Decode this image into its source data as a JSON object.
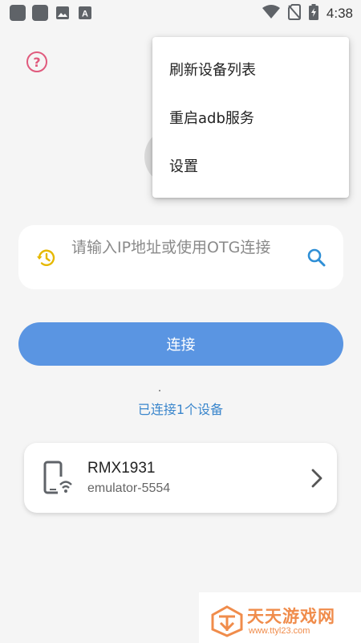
{
  "status_bar": {
    "time": "4:38",
    "icons": [
      "app-square-icon",
      "app-square-icon",
      "image-icon",
      "a-icon",
      "wifi-icon",
      "no-sim-icon",
      "battery-charging-icon"
    ]
  },
  "help_icon": "question-circle-icon",
  "menu": {
    "items": [
      "刷新设备列表",
      "重启adb服务",
      "设置"
    ]
  },
  "search": {
    "placeholder": "请输入IP地址或使用OTG连接",
    "history_icon": "history-icon",
    "search_icon": "search-icon"
  },
  "connect_button": {
    "label": "连接"
  },
  "connected_status": "已连接1个设备",
  "devices": [
    {
      "name": "RMX1931",
      "serial": "emulator-5554",
      "icon": "phone-wifi-icon"
    }
  ],
  "watermark": {
    "title": "天天游戏网",
    "url": "www.ttyl23.com"
  },
  "colors": {
    "accent": "#5a95e2",
    "status_text": "#3a86cc",
    "help": "#e05a7d",
    "history": "#e6b800",
    "search_icon": "#2f8fd6"
  }
}
